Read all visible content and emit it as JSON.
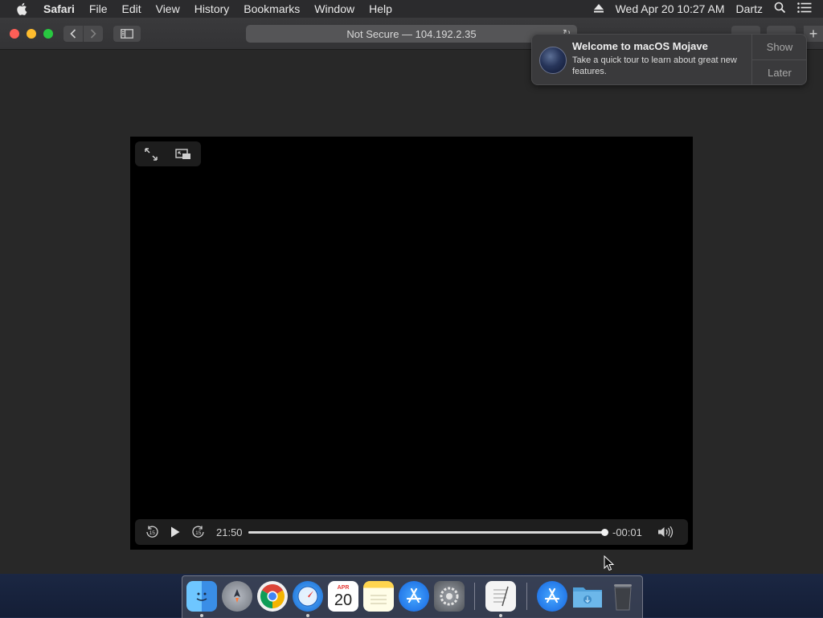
{
  "menubar": {
    "app": "Safari",
    "items": [
      "File",
      "Edit",
      "View",
      "History",
      "Bookmarks",
      "Window",
      "Help"
    ],
    "clock": "Wed Apr 20  10:27 AM",
    "user": "Dartz"
  },
  "browser": {
    "address": "Not Secure — 104.192.2.35"
  },
  "video": {
    "elapsed": "21:50",
    "remaining": "-00:01",
    "progress": 0.999,
    "skip_back_seconds": "15",
    "skip_forward_seconds": "15"
  },
  "notification": {
    "title": "Welcome to macOS Mojave",
    "body": "Take a quick tour to learn about great new features.",
    "show_label": "Show",
    "later_label": "Later"
  },
  "dock": {
    "calendar_month": "APR",
    "calendar_day": "20",
    "items": [
      "finder-icon",
      "launchpad-icon",
      "chrome-icon",
      "safari-icon",
      "calendar-icon",
      "notes-icon",
      "app-store-icon",
      "system-preferences-icon",
      "textedit-icon",
      "app-store-icon",
      "downloads-folder-icon",
      "trash-icon"
    ]
  },
  "colors": {
    "close": "#fe5f57",
    "minimize": "#febc2e",
    "zoom": "#28c840"
  }
}
